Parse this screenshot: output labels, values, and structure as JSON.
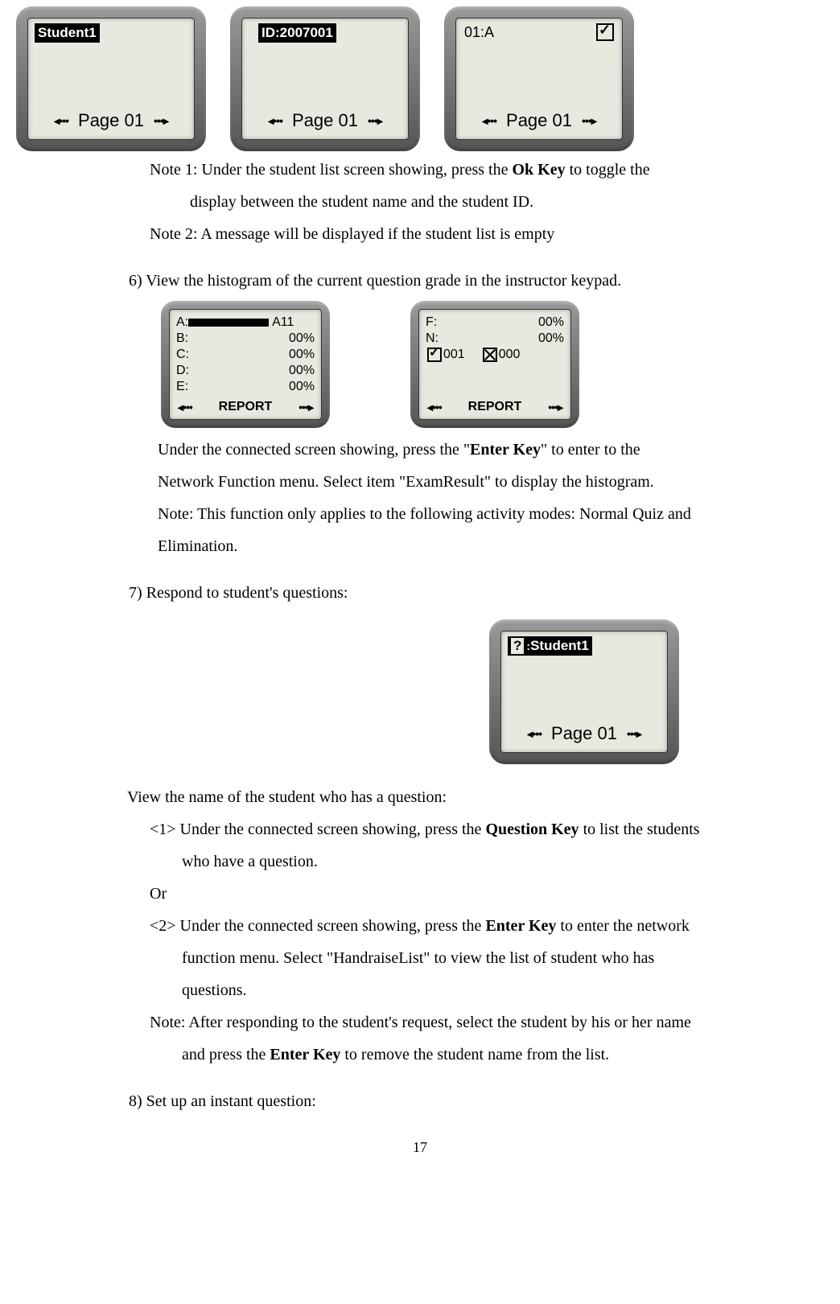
{
  "screens_top": {
    "s1_title": "Student1",
    "s2_title": "ID:2007001",
    "s3_title": "01:A",
    "page_label": "Page  01"
  },
  "note1_a": "Note 1: Under the student list screen showing, press the ",
  "note1_bold": "Ok Key",
  "note1_b": " to toggle the",
  "note1_line2": "display between the student name and the student ID.",
  "note2": "Note 2: A message will be displayed if the student list is empty",
  "step6": "6) View the histogram of the current question grade in the instructor keypad.",
  "hist1": {
    "rows": [
      "A:",
      "B:",
      "C:",
      "D:",
      "E:"
    ],
    "vals": [
      "A11",
      "00%",
      "00%",
      "00%",
      "00%"
    ],
    "bottom": "REPORT"
  },
  "hist2": {
    "f": "F:",
    "fval": "00%",
    "n": "N:",
    "nval": "00%",
    "count1": "001",
    "count2": "000",
    "bottom": "REPORT"
  },
  "under_conn_a": "Under the connected screen showing, press the \"",
  "under_conn_bold": "Enter Key",
  "under_conn_b": "\" to enter to the",
  "under_conn_line2": "Network Function menu. Select item \"ExamResult\" to display the histogram.",
  "note_fun": "Note: This function only applies to the following activity modes: Normal Quiz and",
  "note_fun2": "Elimination.",
  "step7": "7) Respond to student's questions:",
  "qscreen": {
    "title": "Student1",
    "page_label": "Page  01"
  },
  "view_name": "View the name of the student who has a question:",
  "s1_a": "<1> Under the connected screen showing, press the ",
  "s1_bold": "Question Key",
  "s1_b": " to list the students",
  "s1_line2": "who have a question.",
  "or": "Or",
  "s2_a": "<2> Under the connected screen showing, press the ",
  "s2_bold": "Enter Key",
  "s2_b": " to enter the network",
  "s2_line2a": "function menu. Select \"HandraiseList\" to view the list of student who has",
  "s2_line3": "questions.",
  "note7a": "Note: After responding to the student's request, select the student by his or her name",
  "note7b_a": "and press the ",
  "note7b_bold": "Enter Key",
  "note7b_b": " to remove the student name from the list.",
  "step8": "8) Set up an instant question:",
  "page_number": "17"
}
